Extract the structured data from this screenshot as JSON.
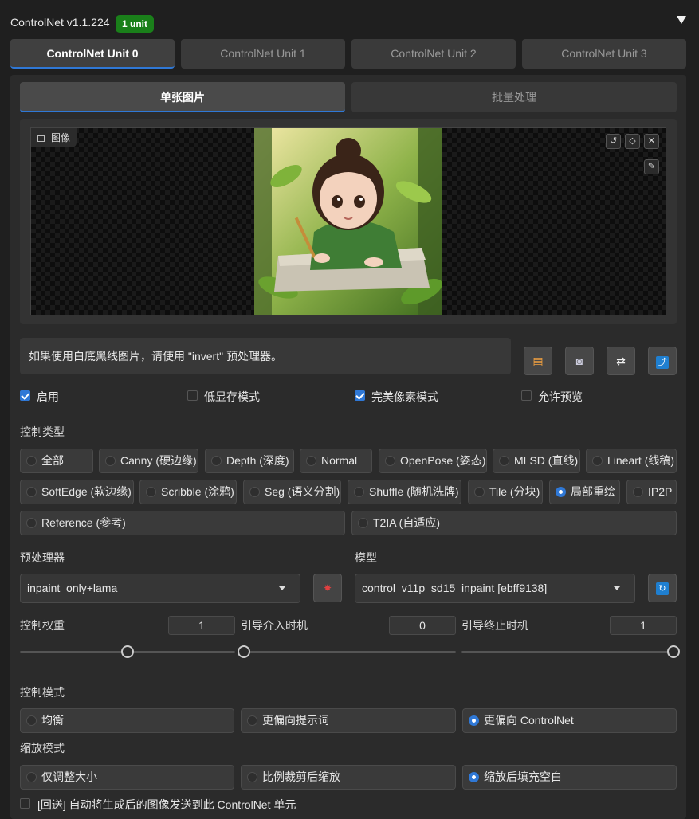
{
  "header": {
    "title": "ControlNet v1.1.224",
    "badge": "1 unit"
  },
  "unit_tabs": [
    "ControlNet Unit 0",
    "ControlNet Unit 1",
    "ControlNet Unit 2",
    "ControlNet Unit 3"
  ],
  "sub_tabs": [
    "单张图片",
    "批量处理"
  ],
  "image": {
    "label": "图像"
  },
  "hint": "如果使用白底黑线图片，请使用 \"invert\" 预处理器。",
  "checks": [
    {
      "label": "启用",
      "checked": true
    },
    {
      "label": "低显存模式",
      "checked": false
    },
    {
      "label": "完美像素模式",
      "checked": true
    },
    {
      "label": "允许预览",
      "checked": false
    }
  ],
  "control_type": {
    "label": "控制类型",
    "options": [
      "全部",
      "Canny (硬边缘)",
      "Depth (深度)",
      "Normal",
      "OpenPose (姿态)",
      "MLSD (直线)",
      "Lineart (线稿)",
      "SoftEdge (软边缘)",
      "Scribble (涂鸦)",
      "Seg (语义分割)",
      "Shuffle (随机洗牌)",
      "Tile (分块)",
      "局部重绘",
      "IP2P",
      "Reference (参考)",
      "T2IA (自适应)"
    ],
    "selected": "局部重绘"
  },
  "preprocessor": {
    "label": "预处理器",
    "value": "inpaint_only+lama"
  },
  "model": {
    "label": "模型",
    "value": "control_v11p_sd15_inpaint [ebff9138]"
  },
  "sliders": [
    {
      "label": "控制权重",
      "value": "1",
      "fraction": 0.5
    },
    {
      "label": "引导介入时机",
      "value": "0",
      "fraction": 0.0
    },
    {
      "label": "引导终止时机",
      "value": "1",
      "fraction": 1.0
    }
  ],
  "control_mode": {
    "label": "控制模式",
    "options": [
      "均衡",
      "更偏向提示词",
      "更偏向 ControlNet"
    ],
    "selected": "更偏向 ControlNet"
  },
  "resize_mode": {
    "label": "缩放模式",
    "options": [
      "仅调整大小",
      "比例裁剪后缩放",
      "缩放后填充空白"
    ],
    "selected": "缩放后填充空白"
  },
  "loopback": {
    "label": "[回送] 自动将生成后的图像发送到此 ControlNet 单元",
    "checked": false
  },
  "colors": {
    "accent": "#2f78d6",
    "badge": "#1a7f1a",
    "background": "#1f1f1f",
    "panel": "#2b2b2b"
  }
}
